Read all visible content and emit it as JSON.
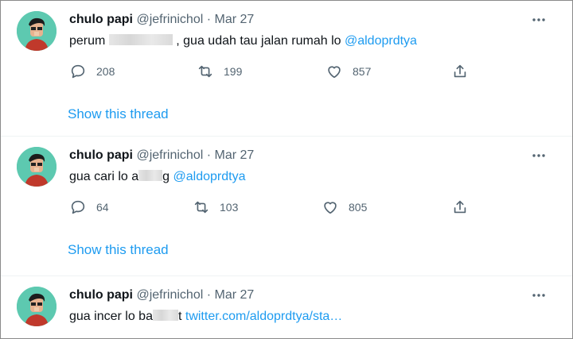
{
  "tweets": [
    {
      "name": "chulo papi",
      "handle": "@jefrinichol",
      "separator": "·",
      "date": "Mar 27",
      "text_before": "perum",
      "redacted": true,
      "text_after": ", gua udah tau jalan rumah lo",
      "mention": "@aldoprdtya",
      "replies": "208",
      "retweets": "199",
      "likes": "857",
      "show_thread": "Show this thread"
    },
    {
      "name": "chulo papi",
      "handle": "@jefrinichol",
      "separator": "·",
      "date": "Mar 27",
      "text_before": "gua cari lo a",
      "redacted": true,
      "text_after": "g",
      "mention": "@aldoprdtya",
      "replies": "64",
      "retweets": "103",
      "likes": "805",
      "show_thread": "Show this thread"
    },
    {
      "name": "chulo papi",
      "handle": "@jefrinichol",
      "separator": "·",
      "date": "Mar 27",
      "text_before": "gua incer lo ba",
      "redacted": true,
      "text_after": "t",
      "link": "twitter.com/aldoprdtya/sta…"
    }
  ],
  "icons": {
    "more": "more-horizontal-icon",
    "reply": "reply-icon",
    "retweet": "retweet-icon",
    "like": "heart-icon",
    "share": "share-icon"
  },
  "colors": {
    "accent": "#1d9bf0",
    "secondary_text": "#536471",
    "avatar_bg": "#5dc9b0"
  }
}
